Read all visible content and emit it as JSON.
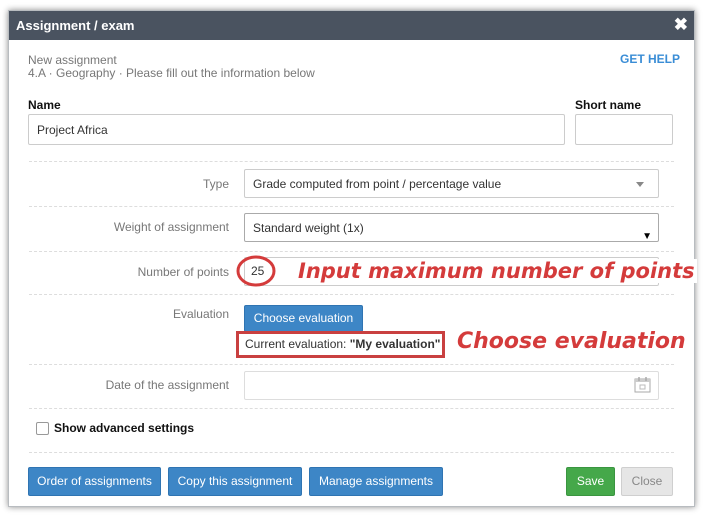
{
  "dialog": {
    "title": "Assignment / exam",
    "close_glyph": "✖",
    "subtitle_line1": "New assignment",
    "subtitle_line2": "4.A · Geography · Please fill out the information below",
    "help_link": "GET HELP"
  },
  "form": {
    "name_label": "Name",
    "name_value": "Project Africa",
    "short_name_label": "Short name",
    "short_name_value": "",
    "type_label": "Type",
    "type_value": "Grade computed from point / percentage value",
    "weight_label": "Weight of assignment",
    "weight_value": "Standard weight (1x)",
    "points_label": "Number of points",
    "points_value": "25",
    "evaluation_label": "Evaluation",
    "choose_evaluation_button": "Choose evaluation",
    "current_evaluation_prefix": "Current evaluation:",
    "current_evaluation_value": "\"My evaluation\"",
    "date_label": "Date of the assignment",
    "date_value": "",
    "advanced_settings_label": "Show advanced settings",
    "advanced_settings_checked": false
  },
  "annotations": {
    "points_note": "Input maximum number of points",
    "evaluation_note": "Choose evaluation",
    "color": "#d43b3b"
  },
  "footer": {
    "order_button": "Order of assignments",
    "copy_button": "Copy this assignment",
    "manage_button": "Manage assignments",
    "save_button": "Save",
    "close_button": "Close"
  },
  "colors": {
    "titlebar": "#4a5360",
    "primary_button": "#3d86c6",
    "save_button": "#45a84a",
    "link": "#3a8dd6"
  },
  "icons": {
    "close": "close-icon",
    "select_caret": "chevron-down-icon",
    "calendar": "calendar-icon"
  }
}
